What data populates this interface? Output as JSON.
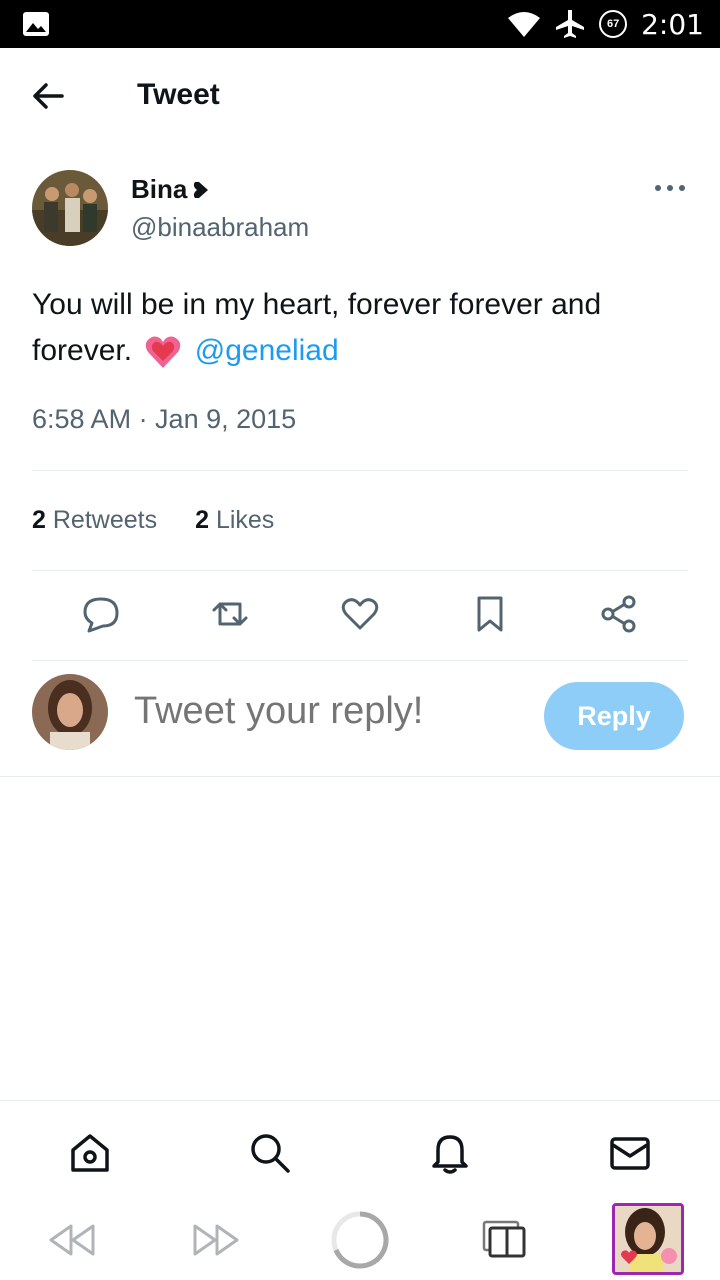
{
  "status_bar": {
    "time": "2:01",
    "battery": "67"
  },
  "header": {
    "title": "Tweet"
  },
  "tweet": {
    "author_name": "Bina",
    "author_handle": "@binaabraham",
    "text": "You will be in my heart, forever forever and forever.",
    "mention": "@geneliad",
    "timestamp": "6:58 AM · Jan 9, 2015",
    "retweets_count": "2",
    "retweets_label": "Retweets",
    "likes_count": "2",
    "likes_label": "Likes"
  },
  "reply": {
    "placeholder": "Tweet your reply!",
    "button_label": "Reply"
  },
  "colors": {
    "accent": "#1d9bf0",
    "reply_button": "#8ecdf8",
    "secondary_text": "#536471"
  }
}
